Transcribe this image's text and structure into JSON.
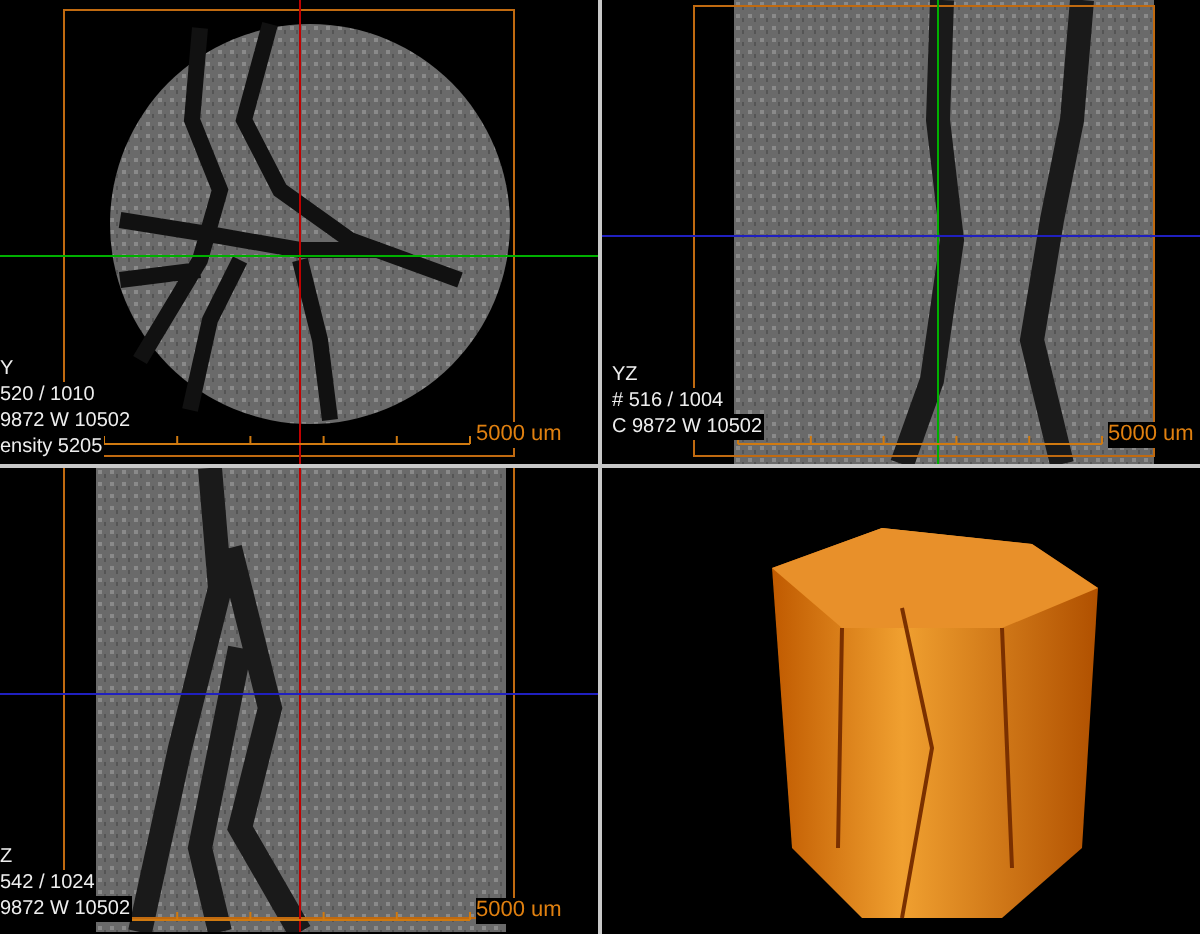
{
  "panes": [
    {
      "kind": "axial-slice",
      "info": [
        "Y",
        "520 / 1010",
        "9872 W 10502",
        "ensity 5205"
      ],
      "scale": "5000 um"
    },
    {
      "kind": "vertical-slice",
      "info": [
        "YZ",
        "# 516 / 1004",
        "C 9872 W 10502"
      ],
      "scale": "5000 um"
    },
    {
      "kind": "vertical-slice",
      "info": [
        "Z",
        "542 / 1024",
        "9872 W 10502"
      ],
      "scale": "5000 um"
    },
    {
      "kind": "render-3d"
    }
  ]
}
